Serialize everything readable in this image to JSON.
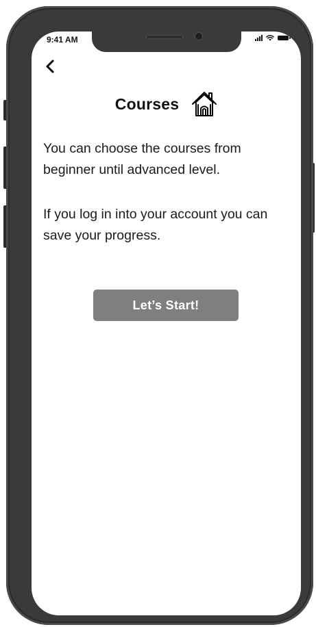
{
  "status_bar": {
    "time": "9:41 AM",
    "icons": [
      "signal-icon",
      "wifi-icon",
      "battery-icon"
    ]
  },
  "nav": {
    "back_icon": "chevron-left-icon"
  },
  "header": {
    "title": "Courses",
    "icon": "home-icon"
  },
  "content": {
    "paragraph_1": "You can choose the courses from beginner until advanced level.",
    "paragraph_2": "If you log in into your account you can save your progress."
  },
  "actions": {
    "start_label": "Let’s Start!"
  },
  "colors": {
    "frame": "#3a3a3a",
    "button_bg": "#7f7f7f",
    "button_text": "#ffffff",
    "text": "#1a1a1a",
    "screen_bg": "#ffffff"
  }
}
